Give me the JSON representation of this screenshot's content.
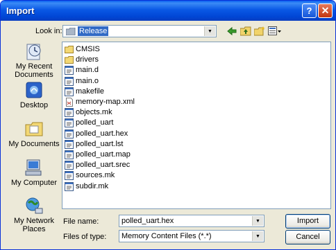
{
  "window": {
    "title": "Import"
  },
  "titlebar": {
    "help_label": "?",
    "close_label": "✕"
  },
  "lookin": {
    "label": "Look in:",
    "value": "Release"
  },
  "toolbar": {
    "icons": [
      "back-arrow-icon",
      "up-folder-icon",
      "new-folder-icon",
      "views-menu-icon"
    ]
  },
  "places": [
    {
      "label": "My Recent Documents",
      "icon": "recent-documents-icon"
    },
    {
      "label": "Desktop",
      "icon": "desktop-icon"
    },
    {
      "label": "My Documents",
      "icon": "my-documents-icon"
    },
    {
      "label": "My Computer",
      "icon": "my-computer-icon"
    },
    {
      "label": "My Network Places",
      "icon": "network-places-icon"
    }
  ],
  "files": [
    {
      "name": "CMSIS",
      "type": "folder"
    },
    {
      "name": "drivers",
      "type": "folder"
    },
    {
      "name": "main.d",
      "type": "file"
    },
    {
      "name": "main.o",
      "type": "file"
    },
    {
      "name": "makefile",
      "type": "file"
    },
    {
      "name": "memory-map.xml",
      "type": "xml"
    },
    {
      "name": "objects.mk",
      "type": "file"
    },
    {
      "name": "polled_uart",
      "type": "file"
    },
    {
      "name": "polled_uart.hex",
      "type": "file"
    },
    {
      "name": "polled_uart.lst",
      "type": "file"
    },
    {
      "name": "polled_uart.map",
      "type": "file"
    },
    {
      "name": "polled_uart.srec",
      "type": "file"
    },
    {
      "name": "sources.mk",
      "type": "file"
    },
    {
      "name": "subdir.mk",
      "type": "file"
    }
  ],
  "form": {
    "filename_label": "File name:",
    "filename_value": "polled_uart.hex",
    "filetype_label": "Files of type:",
    "filetype_value": "Memory Content Files (*.*)"
  },
  "buttons": {
    "import_label": "Import",
    "cancel_label": "Cancel"
  },
  "colors": {
    "title_blue": "#0a58e5",
    "selection": "#316ac5",
    "dialog_bg": "#ece9d8"
  }
}
